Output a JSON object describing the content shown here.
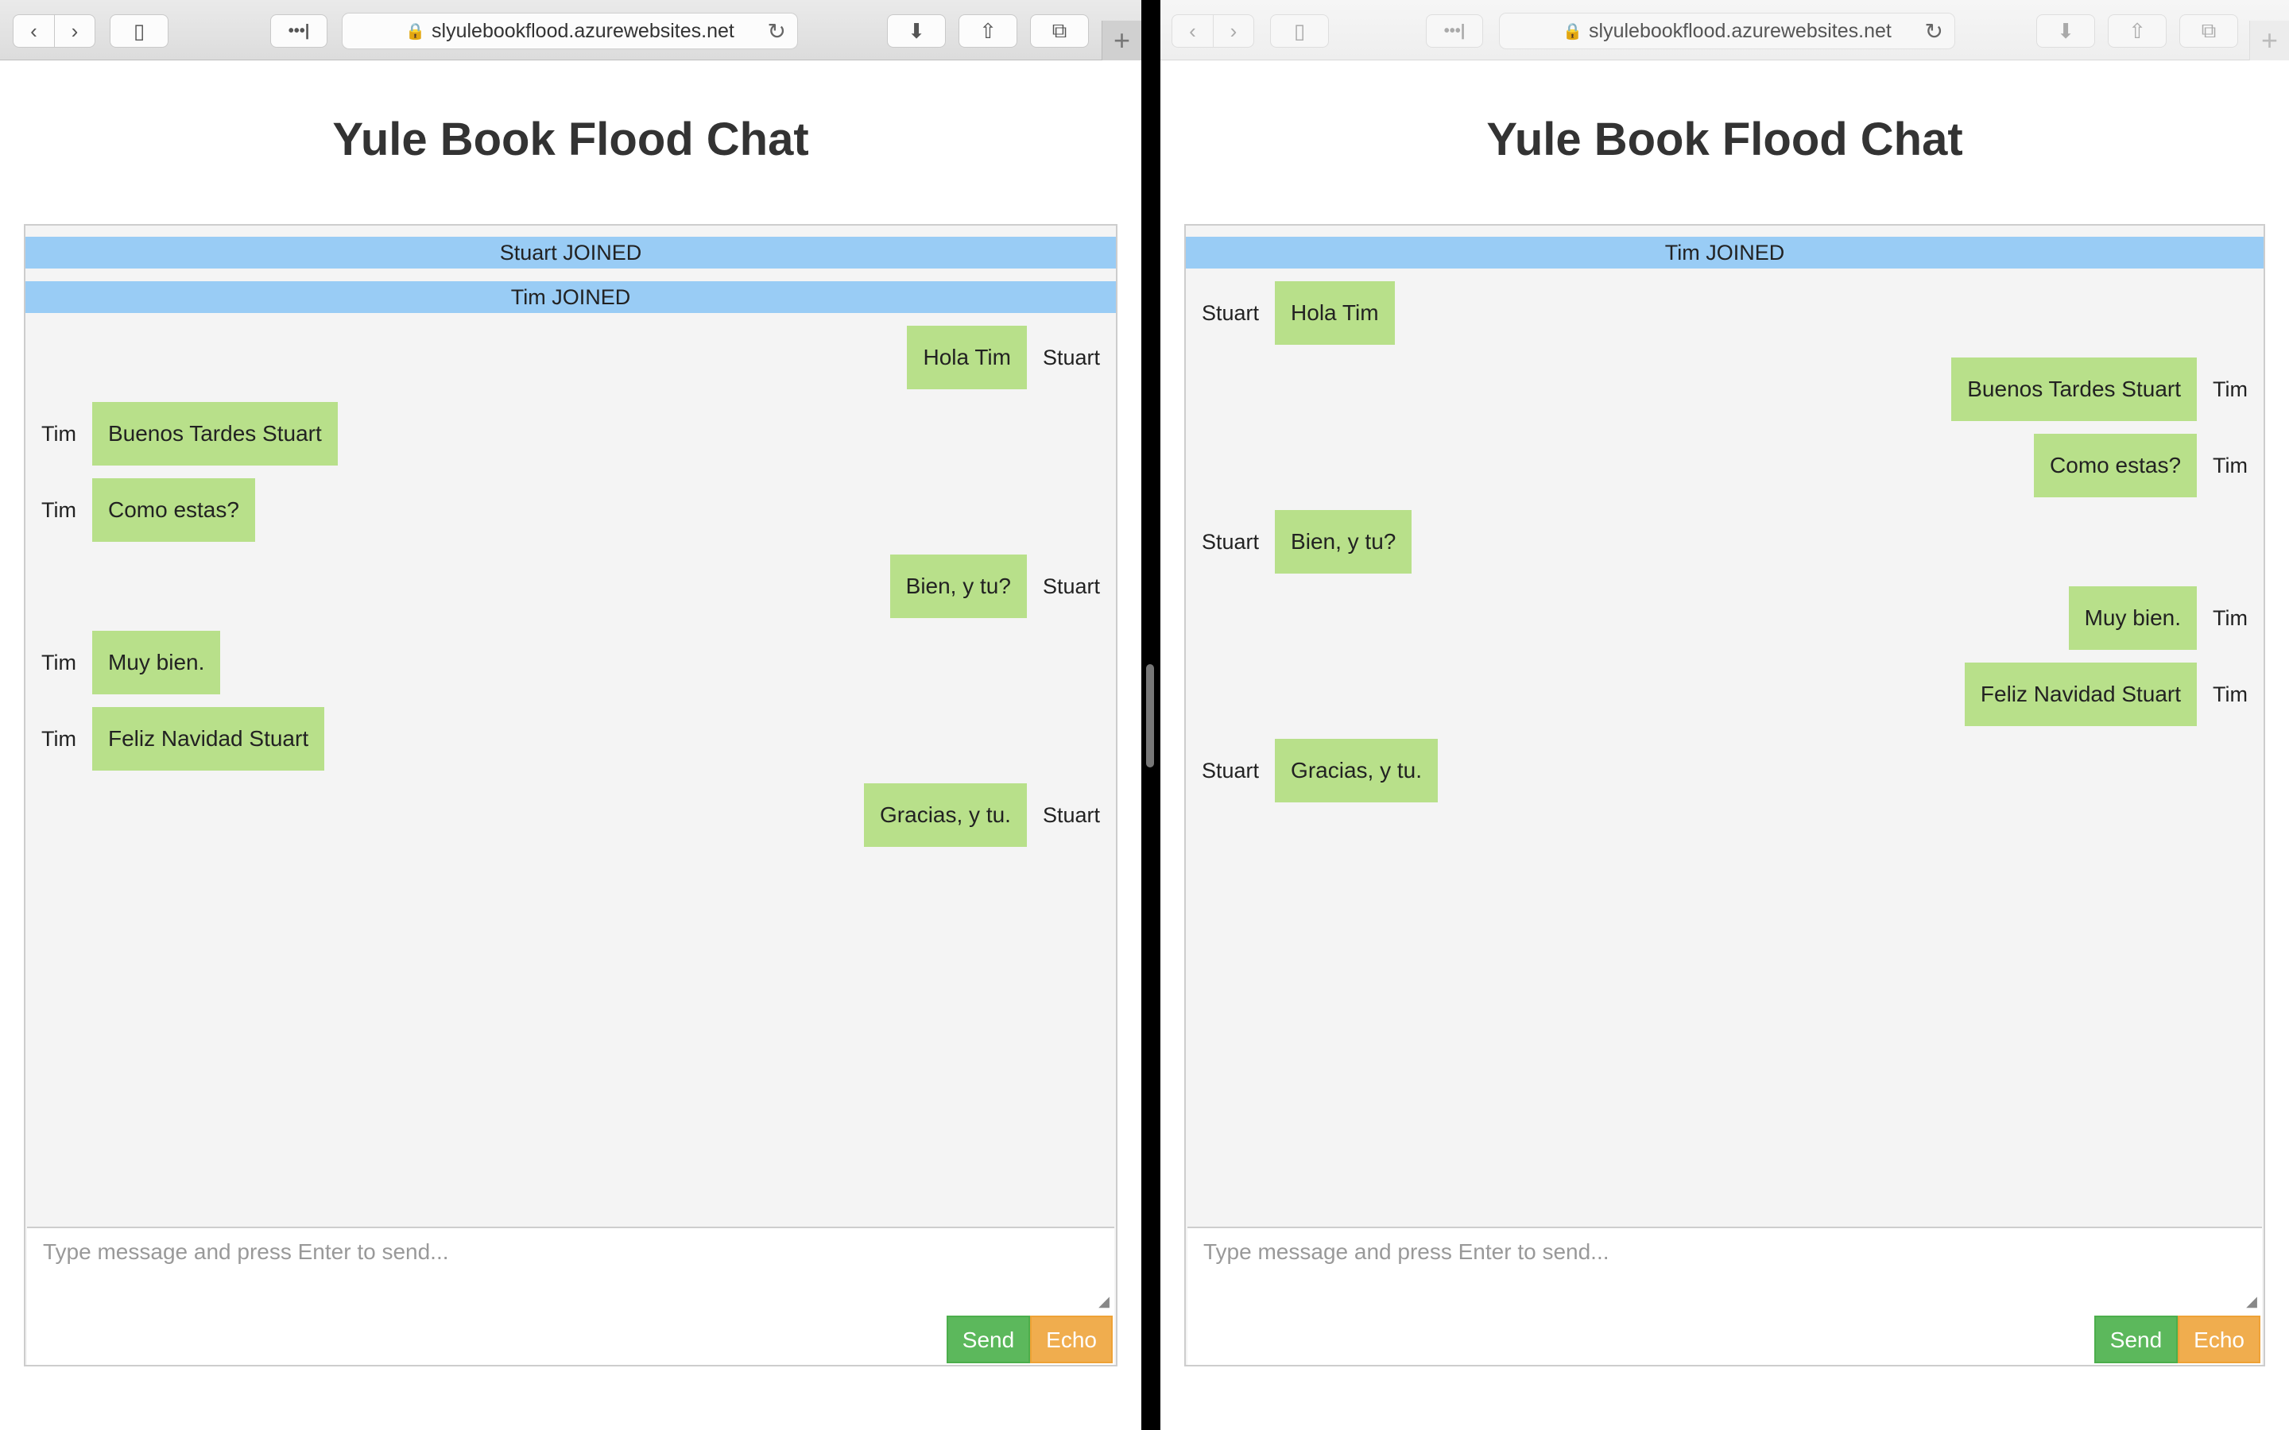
{
  "browser": {
    "url": "slyulebookflood.azurewebsites.net",
    "back_glyph": "‹",
    "forward_glyph": "›",
    "sidebar_glyph": "▯",
    "more_glyph": "•••|",
    "lock_glyph": "🔒",
    "reload_glyph": "↻",
    "download_glyph": "⬇",
    "share_glyph": "⇧",
    "tabs_glyph": "⧉",
    "newtab_glyph": "+"
  },
  "page": {
    "title": "Yule Book Flood Chat",
    "input_placeholder": "Type message and press Enter to send...",
    "send_label": "Send",
    "echo_label": "Echo"
  },
  "left": {
    "messages": [
      {
        "type": "system",
        "text": "Stuart JOINED"
      },
      {
        "type": "system",
        "text": "Tim JOINED"
      },
      {
        "type": "me",
        "sender": "Stuart",
        "text": "Hola Tim"
      },
      {
        "type": "other",
        "sender": "Tim",
        "text": "Buenos Tardes Stuart"
      },
      {
        "type": "other",
        "sender": "Tim",
        "text": "Como estas?"
      },
      {
        "type": "me",
        "sender": "Stuart",
        "text": "Bien, y tu?"
      },
      {
        "type": "other",
        "sender": "Tim",
        "text": "Muy bien."
      },
      {
        "type": "other",
        "sender": "Tim",
        "text": "Feliz Navidad Stuart"
      },
      {
        "type": "me",
        "sender": "Stuart",
        "text": "Gracias, y tu."
      }
    ]
  },
  "right": {
    "messages": [
      {
        "type": "system",
        "text": "Tim JOINED"
      },
      {
        "type": "other",
        "sender": "Stuart",
        "text": "Hola Tim"
      },
      {
        "type": "me",
        "sender": "Tim",
        "text": "Buenos Tardes Stuart"
      },
      {
        "type": "me",
        "sender": "Tim",
        "text": "Como estas?"
      },
      {
        "type": "other",
        "sender": "Stuart",
        "text": "Bien, y tu?"
      },
      {
        "type": "me",
        "sender": "Tim",
        "text": "Muy bien."
      },
      {
        "type": "me",
        "sender": "Tim",
        "text": "Feliz Navidad Stuart"
      },
      {
        "type": "other",
        "sender": "Stuart",
        "text": "Gracias, y tu."
      }
    ]
  }
}
